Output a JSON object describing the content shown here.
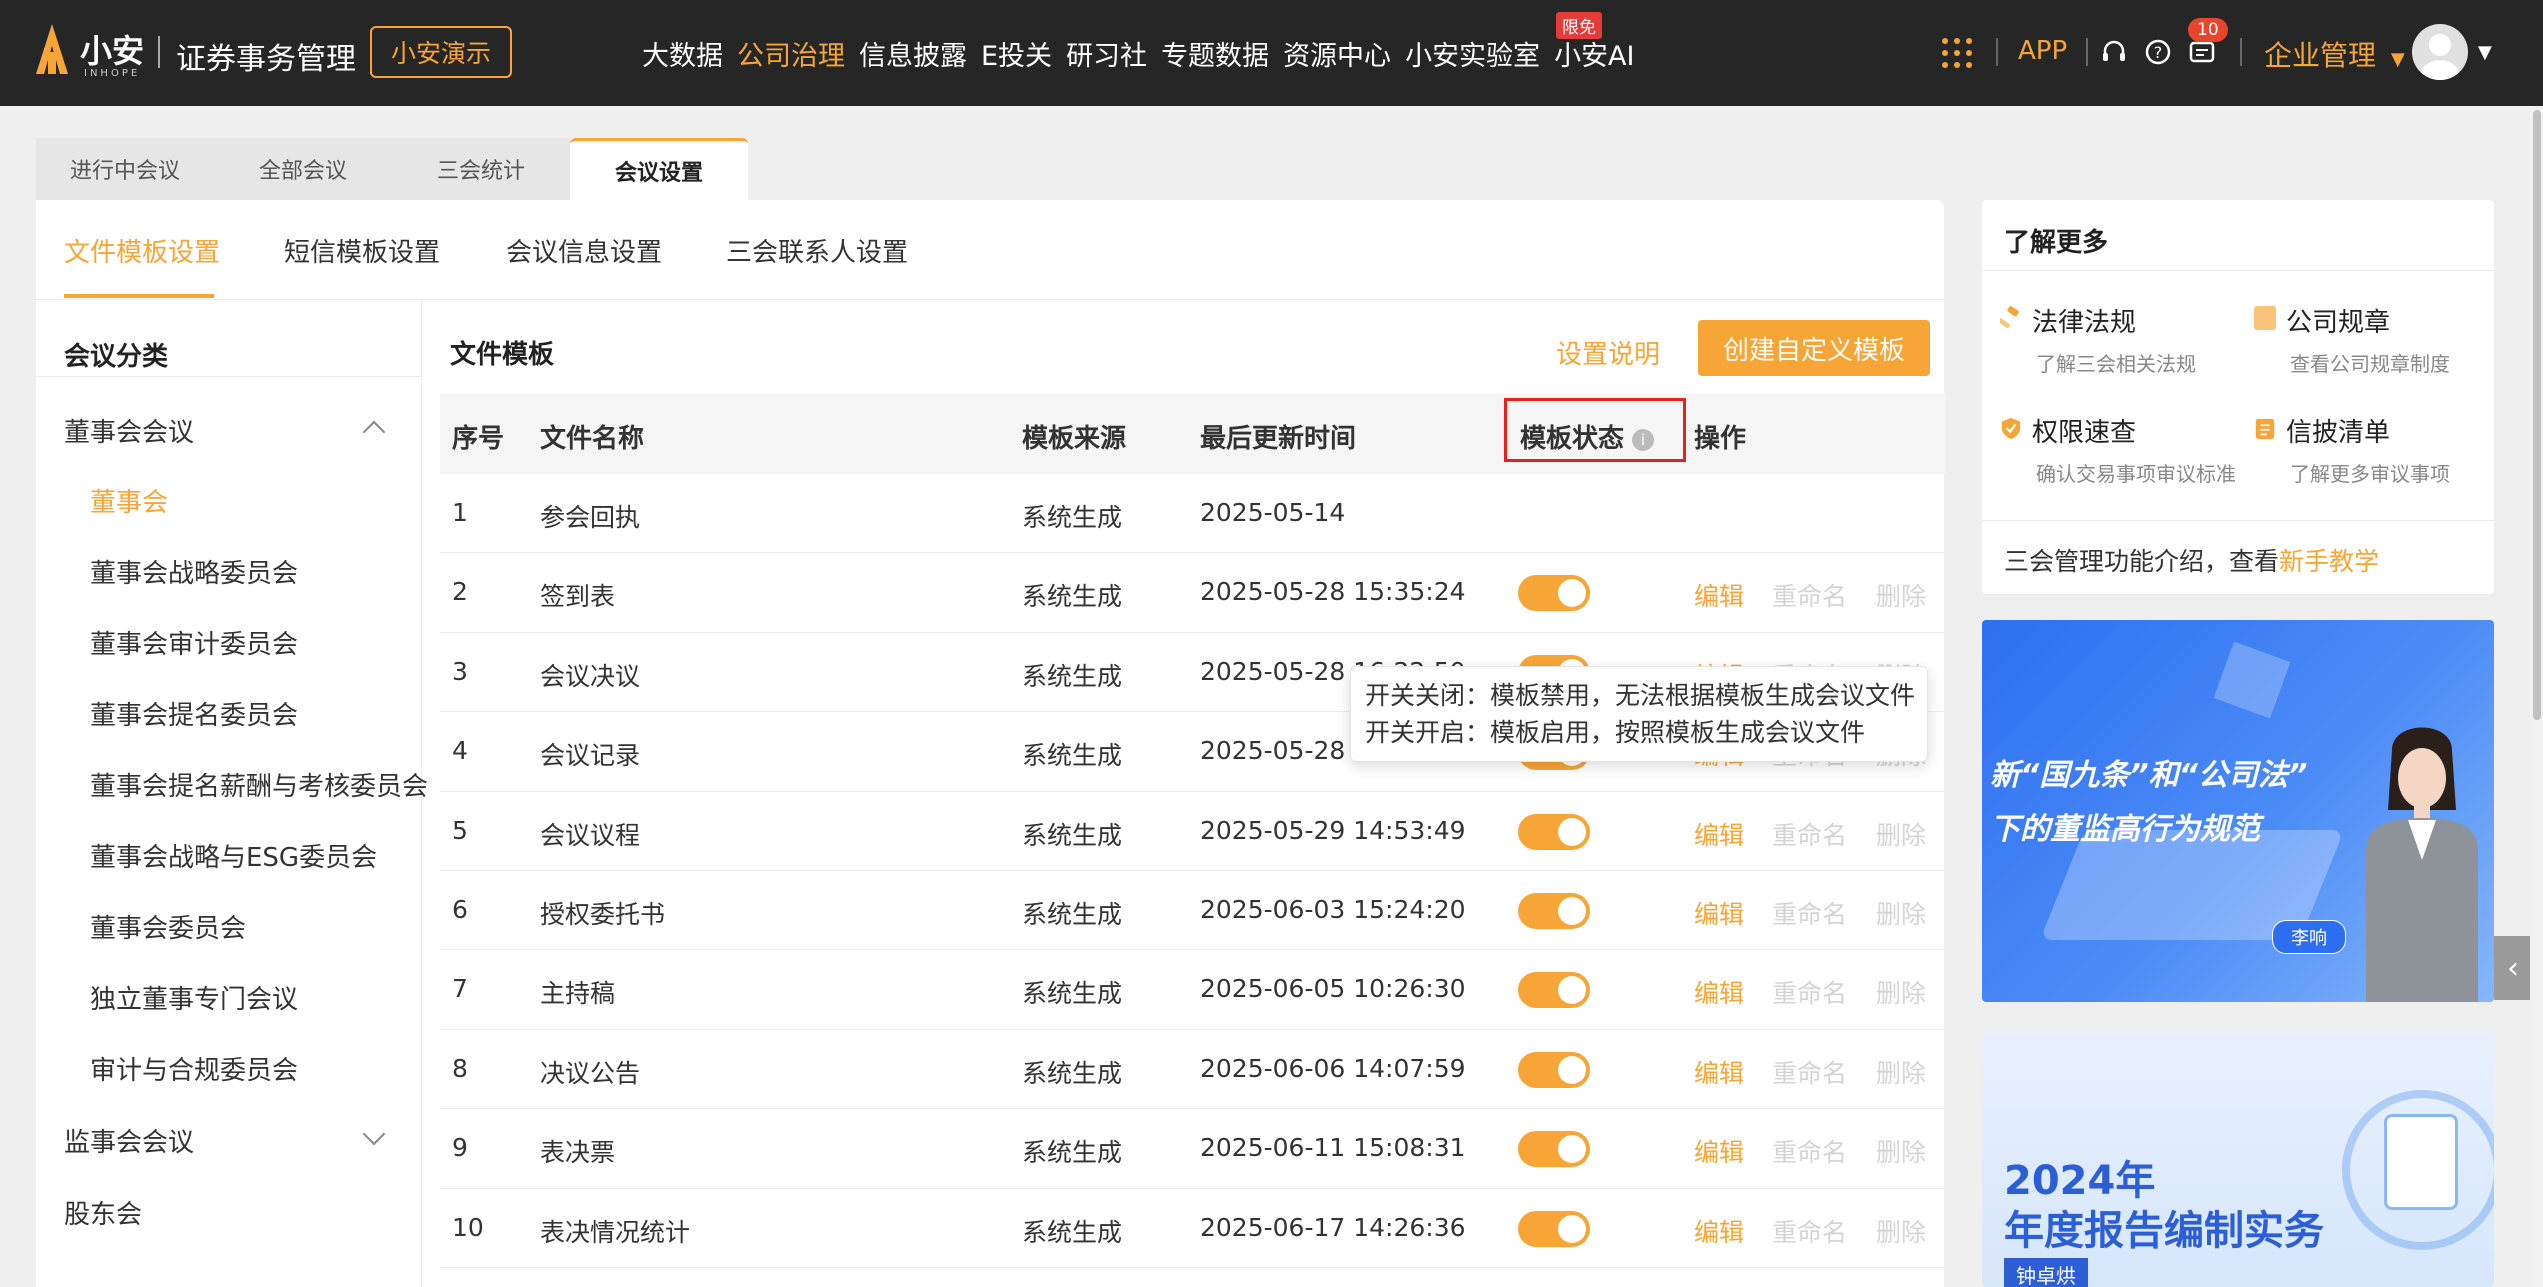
{
  "header": {
    "brand": "小安",
    "brand_sub": "INHOPE",
    "product": "证券事务管理",
    "demo_label": "小安演示",
    "nav": [
      "大数据",
      "公司治理",
      "信息披露",
      "E投关",
      "研习社",
      "专题数据",
      "资源中心",
      "小安实验室",
      "小安AI"
    ],
    "nav_active": "公司治理",
    "free_badge": "限免",
    "app_label": "APP",
    "notification_count": "10",
    "enterprise_label": "企业管理",
    "icons": [
      "apps-grid-icon",
      "headset-icon",
      "help-icon",
      "message-icon",
      "avatar",
      "caret-down-icon"
    ]
  },
  "top_tabs": [
    "进行中会议",
    "全部会议",
    "三会统计",
    "会议设置"
  ],
  "top_tab_active": "会议设置",
  "sub_tabs": [
    "文件模板设置",
    "短信模板设置",
    "会议信息设置",
    "三会联系人设置"
  ],
  "sub_tab_active": "文件模板设置",
  "category": {
    "title": "会议分类",
    "groups": [
      {
        "label": "董事会会议",
        "expanded": true,
        "children": [
          "董事会",
          "董事会战略委员会",
          "董事会审计委员会",
          "董事会提名委员会",
          "董事会提名薪酬与考核委员会",
          "董事会战略与ESG委员会",
          "董事会委员会",
          "独立董事专门会议",
          "审计与合规委员会"
        ]
      },
      {
        "label": "监事会会议",
        "expanded": false,
        "children": []
      },
      {
        "label": "股东会",
        "expanded": false,
        "children": []
      }
    ],
    "active": "董事会"
  },
  "content": {
    "title": "文件模板",
    "help_link": "设置说明",
    "create_button": "创建自定义模板"
  },
  "table": {
    "headers": [
      "序号",
      "文件名称",
      "模板来源",
      "最后更新时间",
      "模板状态",
      "操作"
    ],
    "rows": [
      {
        "no": "1",
        "name": "参会回执",
        "source": "系统生成",
        "time": "2025-05-14"
      },
      {
        "no": "2",
        "name": "签到表",
        "source": "系统生成",
        "time": "2025-05-28 15:35:24"
      },
      {
        "no": "3",
        "name": "会议决议",
        "source": "系统生成",
        "time": "2025-05-28 16:22:50"
      },
      {
        "no": "4",
        "name": "会议记录",
        "source": "系统生成",
        "time": "2025-05-28 16:27:04"
      },
      {
        "no": "5",
        "name": "会议议程",
        "source": "系统生成",
        "time": "2025-05-29 14:53:49"
      },
      {
        "no": "6",
        "name": "授权委托书",
        "source": "系统生成",
        "time": "2025-06-03 15:24:20"
      },
      {
        "no": "7",
        "name": "主持稿",
        "source": "系统生成",
        "time": "2025-06-05 10:26:30"
      },
      {
        "no": "8",
        "name": "决议公告",
        "source": "系统生成",
        "time": "2025-06-06 14:07:59"
      },
      {
        "no": "9",
        "name": "表决票",
        "source": "系统生成",
        "time": "2025-06-11 15:08:31"
      },
      {
        "no": "10",
        "name": "表决情况统计",
        "source": "系统生成",
        "time": "2025-06-17 14:26:36"
      }
    ],
    "actions": {
      "edit": "编辑",
      "rename": "重命名",
      "delete": "删除"
    },
    "status_on": true
  },
  "tooltip": {
    "line1": "开关关闭：模板禁用，无法根据模板生成会议文件",
    "line2": "开关开启：模板启用，按照模板生成会议文件"
  },
  "learn_more": {
    "title": "了解更多",
    "items": [
      {
        "name": "法律法规",
        "desc": "了解三会相关法规",
        "icon": "gavel-icon"
      },
      {
        "name": "公司规章",
        "desc": "查看公司规章制度",
        "icon": "rulebook-icon"
      },
      {
        "name": "权限速查",
        "desc": "确认交易事项审议标准",
        "icon": "shield-icon"
      },
      {
        "name": "信披清单",
        "desc": "了解更多审议事项",
        "icon": "checklist-icon"
      }
    ],
    "footer_prefix": "三会管理功能介绍，查看",
    "footer_link": "新手教学"
  },
  "banner1": {
    "line1": "新“国九条”和“公司法”",
    "line2": "下的董监高行为规范",
    "speaker": "李响"
  },
  "banner2": {
    "title1": "2024年",
    "title2": "年度报告编制实务",
    "author": "钟卓烘"
  },
  "colors": {
    "accent": "#f7a537",
    "header_bg": "#262626",
    "highlight": "#e52222"
  }
}
